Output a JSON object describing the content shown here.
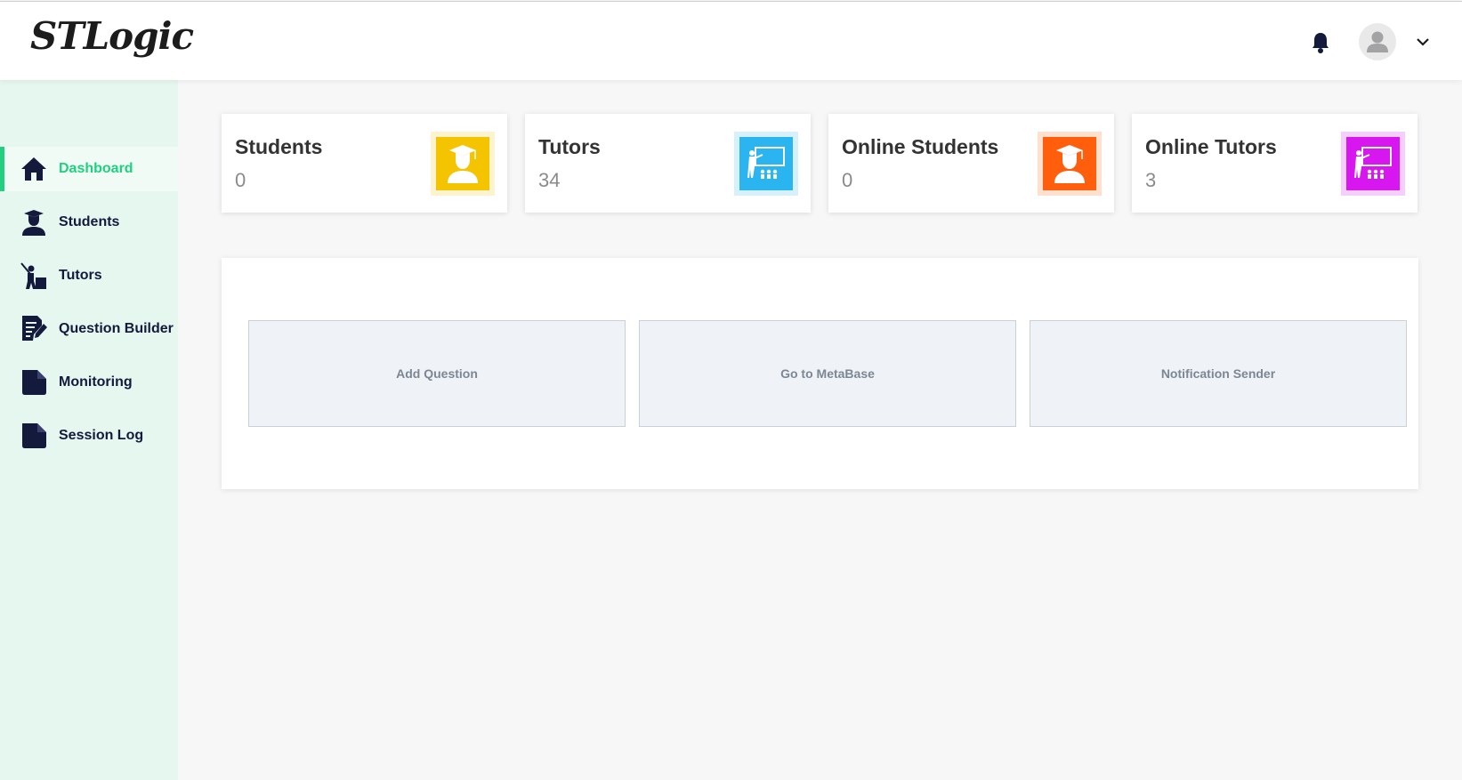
{
  "header": {
    "logo": "STLogic",
    "icons": {
      "notifications": "bell-icon",
      "user": "user-avatar-icon",
      "menu": "chevron-down-icon"
    }
  },
  "sidebar": {
    "items": [
      {
        "label": "Dashboard",
        "icon": "home-icon",
        "active": true
      },
      {
        "label": "Students",
        "icon": "student-icon",
        "active": false
      },
      {
        "label": "Tutors",
        "icon": "tutor-icon",
        "active": false
      },
      {
        "label": "Question Builder",
        "icon": "edit-document-icon",
        "active": false
      },
      {
        "label": "Monitoring",
        "icon": "document-icon",
        "active": false
      },
      {
        "label": "Session Log",
        "icon": "document-icon",
        "active": false
      }
    ]
  },
  "stats": [
    {
      "title": "Students",
      "value": "0",
      "icon": "graduate-icon",
      "color": "#f5c400",
      "tint": "#fdf3cf"
    },
    {
      "title": "Tutors",
      "value": "34",
      "icon": "teacher-icon",
      "color": "#2bb5f0",
      "tint": "#d6f1fc"
    },
    {
      "title": "Online Students",
      "value": "0",
      "icon": "graduate-icon",
      "color": "#ff5e0d",
      "tint": "#ffe0cf"
    },
    {
      "title": "Online Tutors",
      "value": "3",
      "icon": "teacher-icon",
      "color": "#d817f0",
      "tint": "#f5cffb"
    }
  ],
  "actions": [
    {
      "label": "Add Question"
    },
    {
      "label": "Go to MetaBase"
    },
    {
      "label": "Notification Sender"
    }
  ],
  "colors": {
    "accent": "#21d07e",
    "sidebar_bg": "#e5f7ef",
    "nav_text": "#141a3c"
  }
}
